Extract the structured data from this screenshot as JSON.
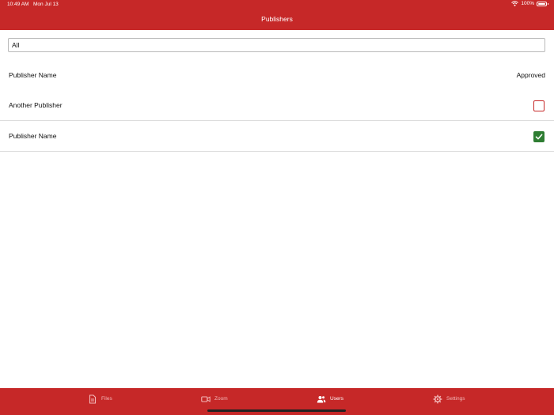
{
  "status_bar": {
    "time": "10:49 AM",
    "date": "Mon Jul 13",
    "battery": "100%"
  },
  "header": {
    "title": "Publishers"
  },
  "filter": {
    "value": "All"
  },
  "columns": {
    "name": "Publisher Name",
    "approved": "Approved"
  },
  "rows": [
    {
      "name": "Another Publisher",
      "approved": false
    },
    {
      "name": "Publisher Name",
      "approved": true
    }
  ],
  "tabs": [
    {
      "label": "Files",
      "icon": "document-icon",
      "active": false
    },
    {
      "label": "Zoom",
      "icon": "video-camera-icon",
      "active": false
    },
    {
      "label": "Users",
      "icon": "users-icon",
      "active": true
    },
    {
      "label": "Settings",
      "icon": "gear-icon",
      "active": false
    }
  ],
  "colors": {
    "accent": "#c62828",
    "approved": "#2e7d32"
  }
}
